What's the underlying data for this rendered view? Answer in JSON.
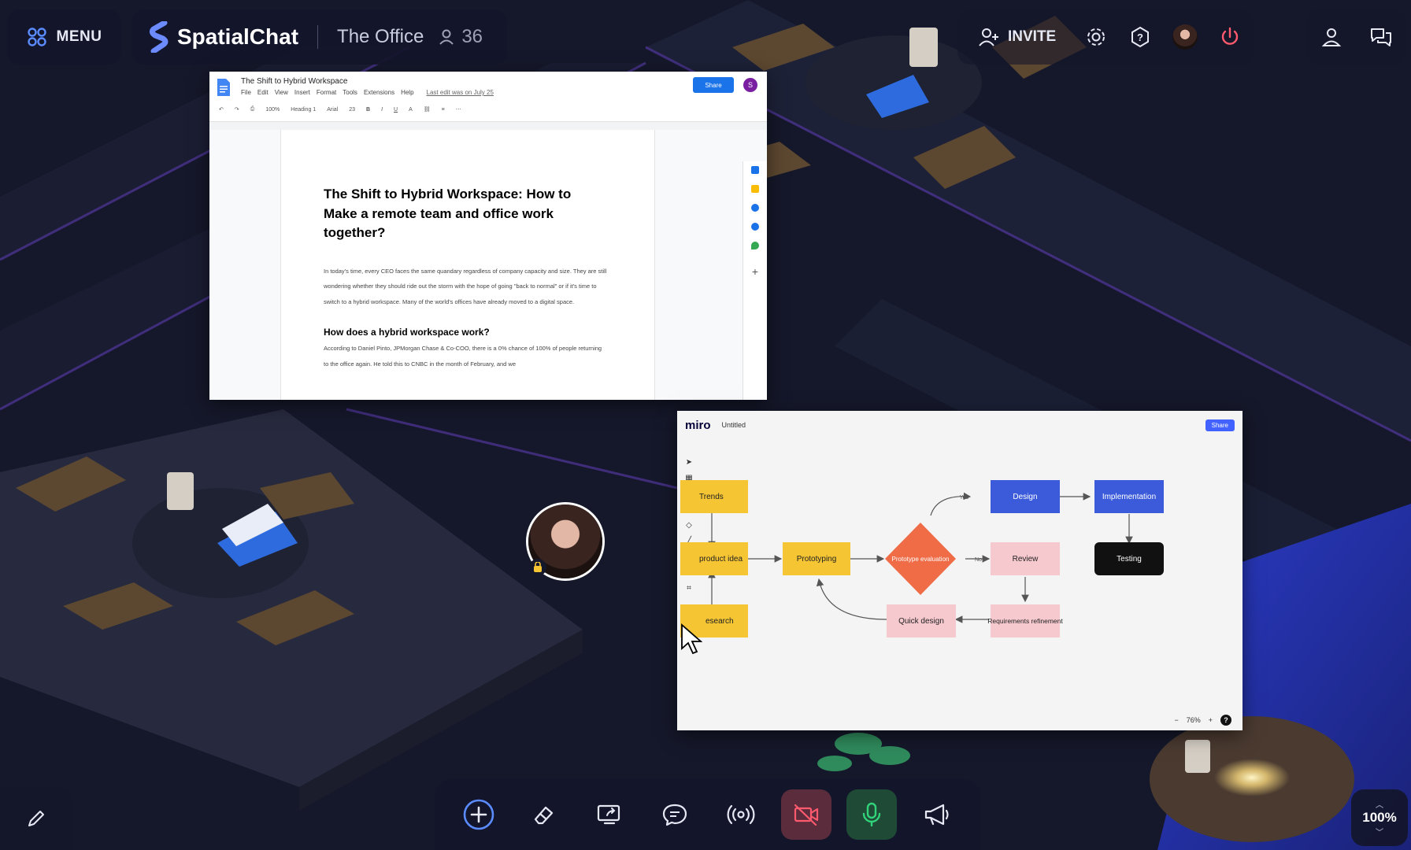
{
  "topbar": {
    "menu_label": "MENU",
    "brand": "SpatialChat",
    "room_name": "The Office",
    "user_count": "36",
    "invite_label": "INVITE"
  },
  "gdocs": {
    "doc_title": "The Shift to Hybrid Workspace",
    "menu_items": [
      "File",
      "Edit",
      "View",
      "Insert",
      "Format",
      "Tools",
      "Extensions",
      "Help"
    ],
    "last_edit": "Last edit was on July 25",
    "share_label": "Share",
    "user_initial": "S",
    "zoom": "100%",
    "style": "Heading 1",
    "font": "Arial",
    "font_size": "23",
    "heading": "The Shift to Hybrid Workspace: How to Make a remote team and office work together?",
    "intro": "In today's time, every CEO faces the same quandary regardless of company capacity and size. They are still wondering whether they should ride out the storm with the hope of going \"back to normal\" or if it's time to switch to a hybrid workspace. Many of the world's offices have already moved to a digital space.",
    "subheading": "How does a hybrid workspace work?",
    "para2": "According to Daniel Pinto, JPMorgan Chase & Co-COO, there is a 0% chance of 100% of people returning to the office again. He told this to CNBC in the month of February, and we"
  },
  "miro": {
    "logo": "miro",
    "board_name": "Untitled",
    "share_label": "Share",
    "zoom": "76%",
    "help": "?",
    "nodes": {
      "trends": "Trends",
      "product_idea": "product idea",
      "research": "esearch",
      "prototyping": "Prototyping",
      "prototype_eval": "Prototype evaluation",
      "design": "Design",
      "implementation": "Implementation",
      "review": "Review",
      "testing": "Testing",
      "quick_design": "Quick design",
      "req_refinement": "Requirements refinement"
    },
    "edge_labels": {
      "yes": "Yes",
      "no": "No"
    }
  },
  "zoom_level": "100%",
  "colors": {
    "accent_blue": "#5b8cff",
    "danger": "#ff5a6e",
    "mic_green": "#32d27a",
    "camera_off_bg": "#5a2c3c",
    "sticky_yellow": "#f5c533",
    "node_blue": "#3b5bdb",
    "node_pink": "#f6c9cf",
    "diamond_orange": "#ef6c47"
  },
  "icons": [
    "grid-icon",
    "spatialchat-logo-icon",
    "user-icon",
    "invite-icon",
    "settings-icon",
    "help-icon",
    "power-icon",
    "profile-icon",
    "chat-bubbles-icon",
    "pencil-icon",
    "add-icon",
    "eraser-icon",
    "screen-share-icon",
    "message-icon",
    "broadcast-icon",
    "camera-off-icon",
    "microphone-icon",
    "megaphone-icon"
  ]
}
